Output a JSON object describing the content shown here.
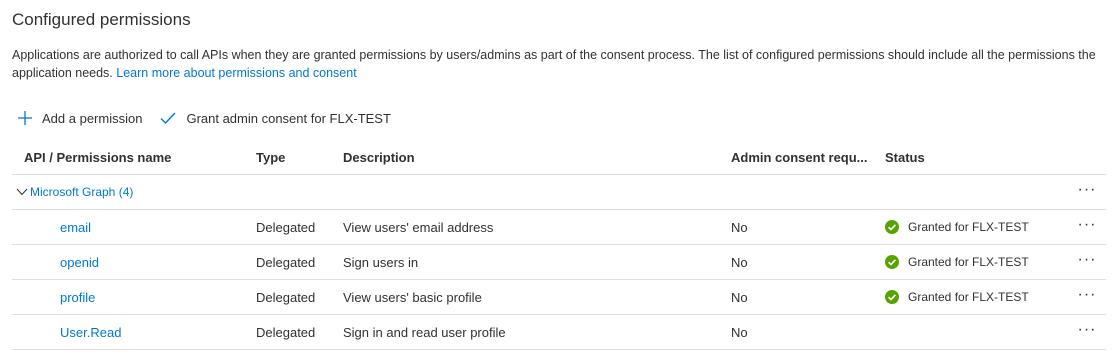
{
  "section": {
    "title": "Configured permissions",
    "description": "Applications are authorized to call APIs when they are granted permissions by users/admins as part of the consent process. The list of configured permissions should include all the permissions the application needs.",
    "learn_more": "Learn more about permissions and consent"
  },
  "toolbar": {
    "add_label": "Add a permission",
    "grant_label": "Grant admin consent for FLX-TEST"
  },
  "table": {
    "headers": {
      "name": "API / Permissions name",
      "type": "Type",
      "description": "Description",
      "consent": "Admin consent requ...",
      "status": "Status"
    },
    "group": {
      "label": "Microsoft Graph (4)",
      "more": "···"
    },
    "rows": [
      {
        "name": "email",
        "type": "Delegated",
        "description": "View users' email address",
        "consent": "No",
        "status": "Granted for FLX-TEST",
        "more": "···"
      },
      {
        "name": "openid",
        "type": "Delegated",
        "description": "Sign users in",
        "consent": "No",
        "status": "Granted for FLX-TEST",
        "more": "···"
      },
      {
        "name": "profile",
        "type": "Delegated",
        "description": "View users' basic profile",
        "consent": "No",
        "status": "Granted for FLX-TEST",
        "more": "···"
      },
      {
        "name": "User.Read",
        "type": "Delegated",
        "description": "Sign in and read user profile",
        "consent": "No",
        "status": "",
        "more": "···"
      }
    ]
  },
  "colors": {
    "link": "#0078d4",
    "granted": "#57a300"
  }
}
